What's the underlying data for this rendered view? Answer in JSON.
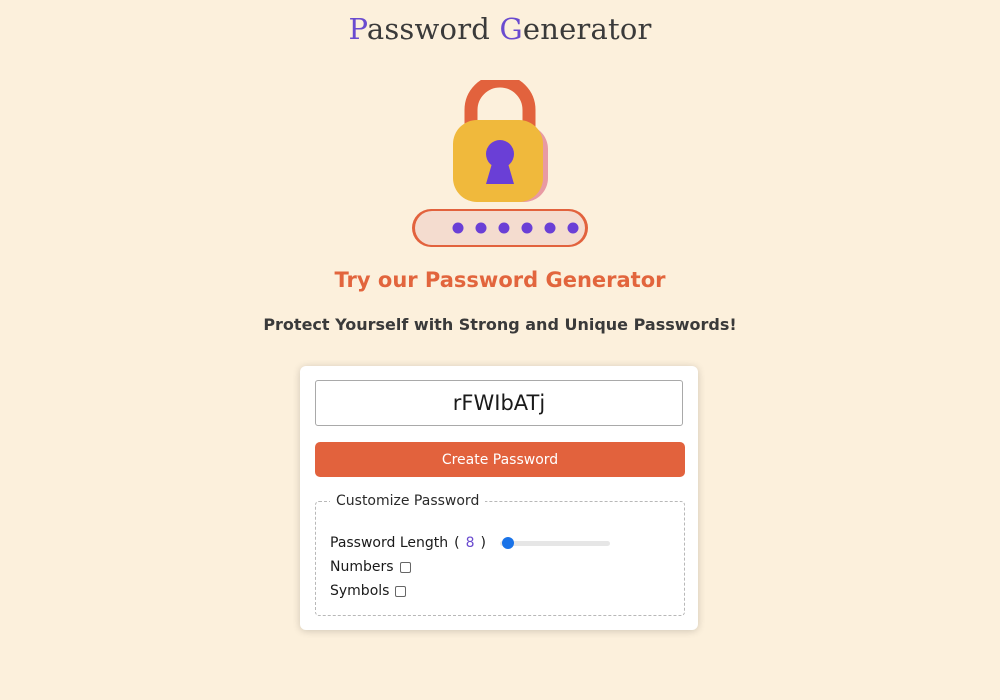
{
  "header": {
    "title_first_initial": "P",
    "title_first_rest": "assword ",
    "title_second_initial": "G",
    "title_second_rest": "enerator",
    "accent_color": "#6a4bcf"
  },
  "hero": {
    "icon": "padlock-with-password-dots-icon",
    "dot_count": 6
  },
  "tagline": "Try our Password Generator",
  "subtitle": "Protect Yourself with Strong and Unique Passwords!",
  "generator": {
    "output_value": "rFWIbATj",
    "create_label": "Create Password",
    "create_color": "#e2623d",
    "customize": {
      "legend": "Customize Password",
      "length_label": "Password Length",
      "length_open": "(",
      "length_value": "8",
      "length_close": ")",
      "length_slider_fraction": 0.0,
      "numbers_label": "Numbers",
      "numbers_checked": false,
      "symbols_label": "Symbols",
      "symbols_checked": false
    }
  },
  "colors": {
    "background": "#fcf0dc",
    "tagline": "#e2653d",
    "slider_thumb": "#1a73e8"
  }
}
